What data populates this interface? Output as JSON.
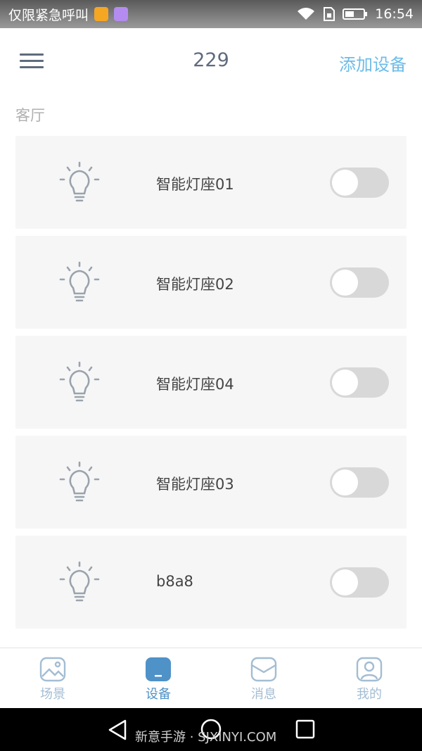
{
  "status_bar": {
    "carrier": "仅限紧急呼叫",
    "time": "16:54",
    "app_icon_colors": [
      "#f5a623",
      "#b48cf0"
    ]
  },
  "header": {
    "title": "229",
    "add_device_label": "添加设备",
    "menu_icon": "menu-icon"
  },
  "section": {
    "label": "客厅"
  },
  "devices": [
    {
      "name": "智能灯座01",
      "icon": "lightbulb-icon",
      "on": false
    },
    {
      "name": "智能灯座02",
      "icon": "lightbulb-icon",
      "on": false
    },
    {
      "name": "智能灯座04",
      "icon": "lightbulb-icon",
      "on": false
    },
    {
      "name": "智能灯座03",
      "icon": "lightbulb-icon",
      "on": false
    },
    {
      "name": "b8a8",
      "icon": "lightbulb-icon",
      "on": false
    }
  ],
  "tabbar": {
    "tabs": [
      {
        "label": "场景",
        "icon": "scene-icon",
        "active": false
      },
      {
        "label": "设备",
        "icon": "device-icon",
        "active": true
      },
      {
        "label": "消息",
        "icon": "message-icon",
        "active": false
      },
      {
        "label": "我的",
        "icon": "profile-icon",
        "active": false
      }
    ]
  },
  "watermark": {
    "text": "新意手游 · SJXINYI.COM"
  },
  "colors": {
    "accent": "#6dbce8",
    "tab_active": "#4f92c8",
    "tab_inactive": "#a3bdd3",
    "toggle_off": "#d8d8d8",
    "icon_gray": "#9aa3ad"
  }
}
